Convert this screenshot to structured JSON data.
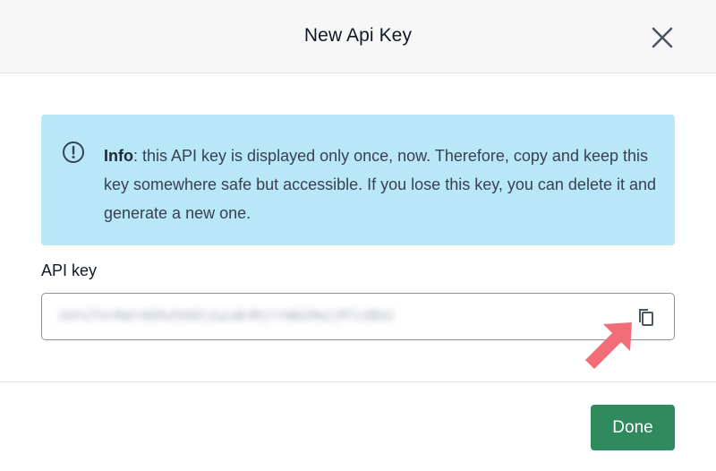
{
  "dialog": {
    "title": "New Api Key",
    "close_icon": "close-icon"
  },
  "info": {
    "icon": "exclamation-circle-icon",
    "label": "Info",
    "message": ": this API key is displayed only once, now. Therefore, copy and keep this key somewhere safe but accessible. If you lose this key, you can delete it and generate a new one.",
    "background_color": "#b8e7f7"
  },
  "api_key_field": {
    "label": "API key",
    "value": "ZmFkZTdlMmEtNGMxOS00ZjUyLWE4MjYtOWQ2MmZjMTIzNDU2",
    "copy_icon": "copy-icon"
  },
  "annotation": {
    "icon": "pointer-arrow-icon",
    "color": "#f26d78"
  },
  "footer": {
    "done_label": "Done",
    "done_color": "#2f8a5e"
  }
}
